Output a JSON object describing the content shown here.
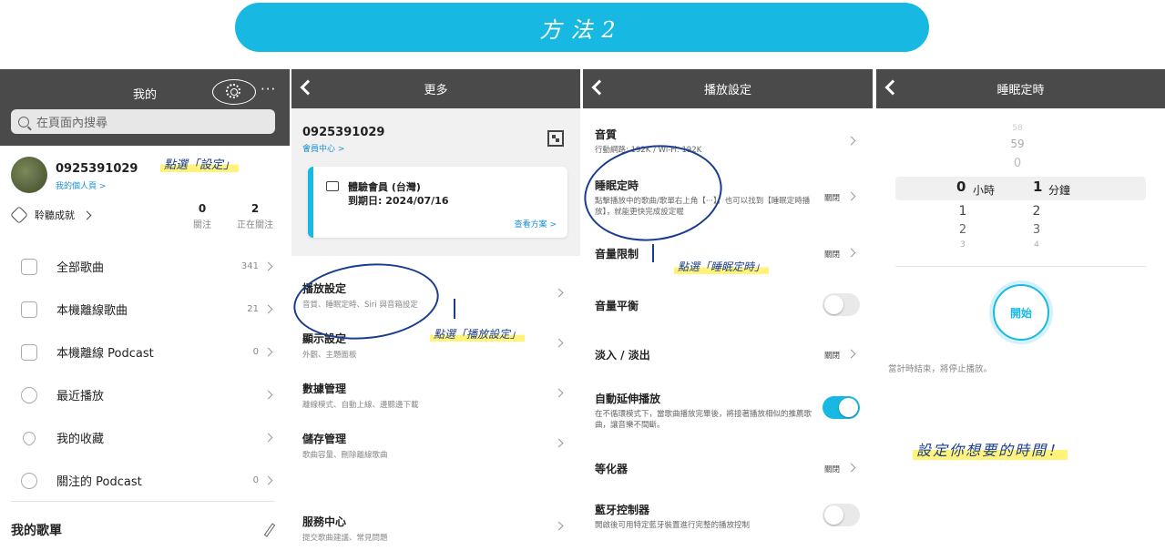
{
  "banner": {
    "title": "方法2"
  },
  "panel1": {
    "title": "我的",
    "more": "···",
    "search_placeholder": "在頁面內搜尋",
    "phone": "0925391029",
    "my_page": "我的個人頁 >",
    "annotation": "點選「設定」",
    "achievement": "聆聽成就",
    "stats": [
      {
        "value": "0",
        "label": "關注"
      },
      {
        "value": "2",
        "label": "正在關注"
      }
    ],
    "menu": [
      {
        "label": "全部歌曲",
        "count": "341",
        "icon": "music-file-icon"
      },
      {
        "label": "本機離線歌曲",
        "count": "21",
        "icon": "download-icon"
      },
      {
        "label": "本機離線 Podcast",
        "count": "0",
        "icon": "download-icon"
      },
      {
        "label": "最近播放",
        "count": "",
        "icon": "clock-icon"
      },
      {
        "label": "我的收藏",
        "count": "",
        "icon": "heart-icon"
      },
      {
        "label": "關注的 Podcast",
        "count": "0",
        "icon": "podcast-icon"
      }
    ],
    "my_playlists": "我的歌單"
  },
  "panel2": {
    "title": "更多",
    "phone": "0925391029",
    "member_center": "會員中心 >",
    "card": {
      "title": "體驗會員 (台灣)",
      "expiry": "到期日: 2024/07/16",
      "link": "查看方案 >"
    },
    "annotation": "點選「播放設定」",
    "rows": [
      {
        "title": "播放設定",
        "desc": "音質、睡眠定時、Siri 與音箱設定"
      },
      {
        "title": "顯示設定",
        "desc": "外觀、主題面板"
      },
      {
        "title": "數據管理",
        "desc": "離線模式、自動上線、邊聽邊下載"
      },
      {
        "title": "儲存管理",
        "desc": "歌曲容量、刪除離線歌曲"
      },
      {
        "title": "服務中心",
        "desc": "提交歌曲建議、常見問題"
      }
    ]
  },
  "panel3": {
    "title": "播放設定",
    "annotation": "點選「睡眠定時」",
    "rows": [
      {
        "title": "音質",
        "desc": "行動網路: 192K / Wi-Fi: 192K",
        "value": ""
      },
      {
        "title": "睡眠定時",
        "desc": "點擊播放中的歌曲/歌單右上角【···】，也可以找到【睡眠定時播放】，就能更快完成設定喔",
        "value": "關閉"
      },
      {
        "title": "音量限制",
        "desc": "",
        "value": "關閉"
      },
      {
        "title": "音量平衡",
        "desc": "",
        "value": ""
      },
      {
        "title": "淡入 / 淡出",
        "desc": "",
        "value": "關閉"
      },
      {
        "title": "自動延伸播放",
        "desc": "在不循環模式下，當歌曲播放完畢後，將接著播放相似的推薦歌曲，讓音樂不間斷。",
        "value": ""
      },
      {
        "title": "等化器",
        "desc": "",
        "value": "關閉"
      },
      {
        "title": "藍牙控制器",
        "desc": "開啟後可用特定藍牙裝置進行完整的播放控制",
        "value": ""
      }
    ]
  },
  "panel4": {
    "title": "睡眠定時",
    "hours_col": [
      "58",
      "59",
      "0",
      "1",
      "2",
      "3"
    ],
    "hours_selected": "0",
    "hours_unit": "小時",
    "minutes_col": [
      "1",
      "2",
      "3",
      "4"
    ],
    "minutes_selected": "1",
    "minutes_unit": "分鐘",
    "hours_col_below": [
      "1",
      "2",
      "3"
    ],
    "start": "開始",
    "hint": "當計時結束，將停止播放。",
    "annotation": "設定你想要的時間！"
  },
  "colors": {
    "accent": "#17b9e2",
    "navbar": "#4a4a4a",
    "annotation": "#1a3d8f",
    "highlight": "#fff37a"
  }
}
